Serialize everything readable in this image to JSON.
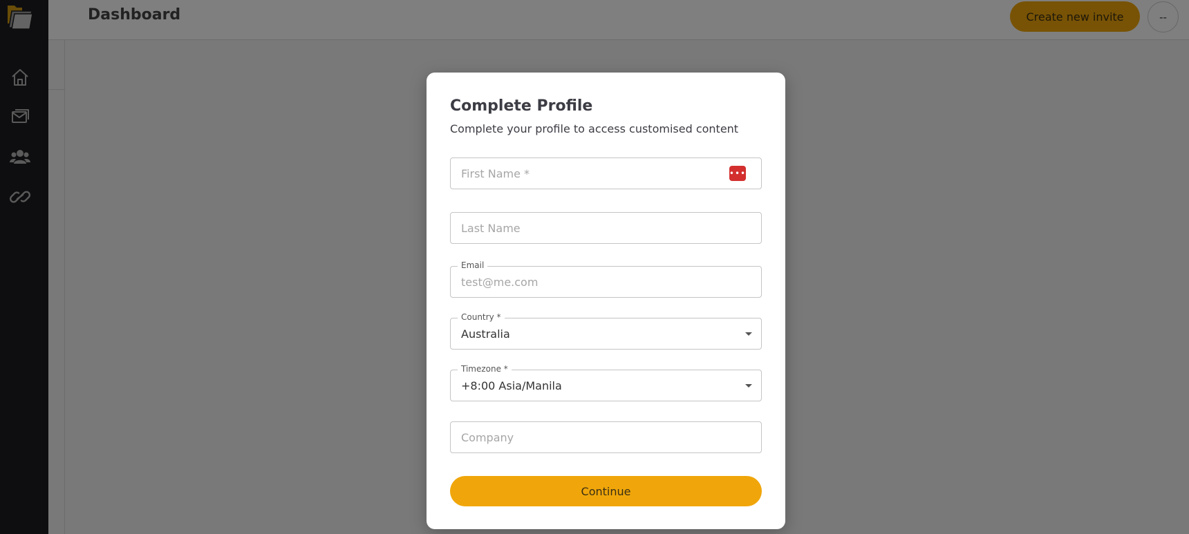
{
  "header": {
    "title": "Dashboard",
    "invite_button": "Create new invite",
    "avatar_text": "--"
  },
  "sidebar": {
    "items": [
      {
        "icon": "home-icon"
      },
      {
        "icon": "mail-icon"
      },
      {
        "icon": "users-icon"
      },
      {
        "icon": "link-icon"
      }
    ]
  },
  "modal": {
    "title": "Complete Profile",
    "subtitle": "Complete your profile to access customised content",
    "first_name_placeholder": "First Name *",
    "last_name_placeholder": "Last Name",
    "email_label": "Email",
    "email_placeholder": "test@me.com",
    "country_label": "Country *",
    "country_value": "Australia",
    "timezone_label": "Timezone *",
    "timezone_value": "+8:00 Asia/Manila",
    "company_placeholder": "Company",
    "continue_button": "Continue"
  },
  "colors": {
    "accent": "#f0a60a",
    "sidebar": "#1c1d21",
    "password_manager": "#d32f2f"
  }
}
